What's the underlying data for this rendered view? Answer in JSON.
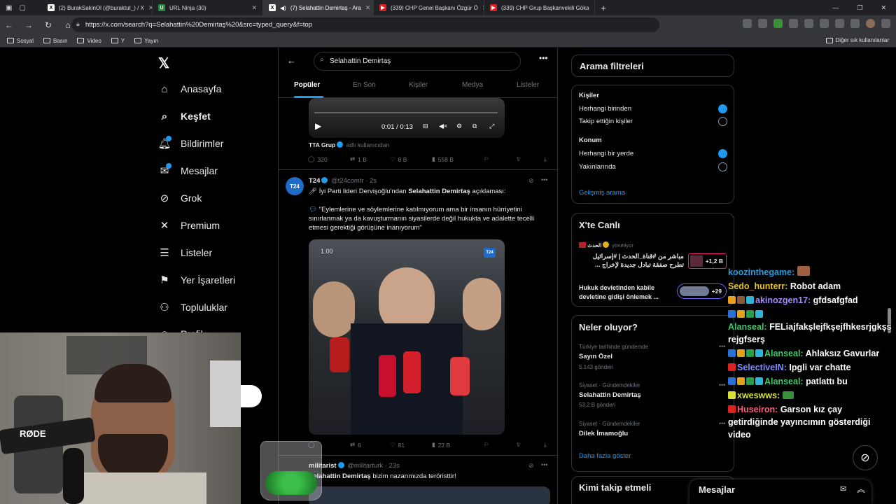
{
  "browser": {
    "tabs": [
      {
        "title": "(2) BurakSakinOl (@buraktut_) / X"
      },
      {
        "title": "URL Ninja (30)"
      },
      {
        "title": "(7) Selahattin Demirtaş - Ara"
      },
      {
        "title": "(339) CHP Genel Başkanı Özgür Ö"
      },
      {
        "title": "(339) CHP Grup Başkanvekili Göka"
      }
    ],
    "url": "https://x.com/search?q=Selahattin%20Demirtaş%20&src=typed_query&f=top",
    "bookmarks": [
      "Sosyal",
      "Basın",
      "Video",
      "Y",
      "Yayın"
    ],
    "bookmarks_other": "Diğer sık kullanılanlar"
  },
  "nav": {
    "items": [
      {
        "label": "Anasayfa"
      },
      {
        "label": "Keşfet"
      },
      {
        "label": "Bildirimler"
      },
      {
        "label": "Mesajlar"
      },
      {
        "label": "Grok"
      },
      {
        "label": "Premium"
      },
      {
        "label": "Listeler"
      },
      {
        "label": "Yer İşaretleri"
      },
      {
        "label": "Topluluklar"
      },
      {
        "label": "Profil"
      }
    ]
  },
  "search": {
    "query": "Selahattin Demirtaş",
    "tabs": [
      "Popüler",
      "En Son",
      "Kişiler",
      "Medya",
      "Listeler"
    ]
  },
  "tweet1": {
    "time": "0:01 / 0:13",
    "source": "TTA Grup",
    "source_suffix": "adlı kullanıcıdan",
    "replies": "320",
    "reposts": "1 B",
    "likes": "8 B",
    "views": "558 B"
  },
  "tweet2": {
    "author": "T24",
    "avatar_text": "T24",
    "handle": "@t24comtr · 2s",
    "line1_prefix": "İyi Parti lideri Dervişoğlu'ndan",
    "line1_bold": "Selahattin Demirtaş",
    "line1_suffix": "açıklaması:",
    "quote": "\"Eylemlerine ve söylemlerine katılmıyorum ama bir insanın hürriyetini sınırlanmak ya da kavuşturmanın siyasilerde değil hukukta ve adalette tecelli etmesi gerektiği görüşüne inanıyorum\"",
    "video_time": "1.00",
    "badge": "T24",
    "reposts": "6",
    "likes": "81",
    "views": "22 B"
  },
  "tweet3": {
    "author": "militarist",
    "handle": "@militarturk · 23s",
    "bold": "Selahattin Demirtaş",
    "text": "bizim nazarımızda teröristtir!"
  },
  "filters": {
    "title": "Arama filtreleri",
    "people_heading": "Kişiler",
    "people_opt1": "Herhangi birinden",
    "people_opt2": "Takip ettiğin kişiler",
    "loc_heading": "Konum",
    "loc_opt1": "Herhangi bir yerde",
    "loc_opt2": "Yakınlarında",
    "advanced": "Gelişmiş arama"
  },
  "live": {
    "title": "X'te Canlı",
    "item1_host": "الحدث",
    "item1_role": "yönetiyor",
    "item1_text": "مباشر من #قناة_الحدث | #إسرائيل تطرح صفقة تبادل جديدة لإخراج ...",
    "item1_count": "+1,2 B",
    "item2_text": "Hukuk devletinden kabile devletine gidişi önlemek ...",
    "item2_count": "+29"
  },
  "trends": {
    "title": "Neler oluyor?",
    "items": [
      {
        "context": "Türkiye tarihinde gündemde",
        "name": "Sayın Özel",
        "count": "5.143 gönderi"
      },
      {
        "context": "Siyaset · Gündemdekiler",
        "name": "Selahattin Demirtaş",
        "count": "53,2 B gönderi"
      },
      {
        "context": "Siyaset · Gündemdekiler",
        "name": "Dilek İmamoğlu",
        "count": ""
      }
    ],
    "more": "Daha fazla göster"
  },
  "follow": {
    "title": "Kimi takip etmeli"
  },
  "messages": {
    "label": "Mesajlar"
  },
  "chat": [
    {
      "user": "koozinthegame:",
      "msg": "",
      "color": "#2d9cdb"
    },
    {
      "user": "Sedo_hunterr:",
      "msg": "Robot adam",
      "color": "#e6c229"
    },
    {
      "user": "akinozgen17:",
      "msg": "gfdsafgfad",
      "color": "#a78bfa"
    },
    {
      "user": "Alanseal:",
      "msg": "FELiajfakşlejfkşejfhkesrjgkşsrejgfserş",
      "color": "#3ec96b"
    },
    {
      "user": "Alanseal:",
      "msg": "Ahlaksız Gavurlar",
      "color": "#3ec96b"
    },
    {
      "user": "SelectiveIN:",
      "msg": "Ipgli var chatte",
      "color": "#7b8cff"
    },
    {
      "user": "Alanseal:",
      "msg": "patlattı bu",
      "color": "#3ec96b"
    },
    {
      "user": "xweswws:",
      "msg": "",
      "color": "#d9e03a"
    },
    {
      "user": "Huseiron:",
      "msg": "Garson kız çay getirdiğinde yayıncımın gösterdiği video",
      "color": "#ff5b7d"
    }
  ],
  "webcam": {
    "mic_brand": "RØDE"
  },
  "colors": {
    "accent": "#1d9bf0",
    "bg": "#000000",
    "border": "#2f3336"
  }
}
